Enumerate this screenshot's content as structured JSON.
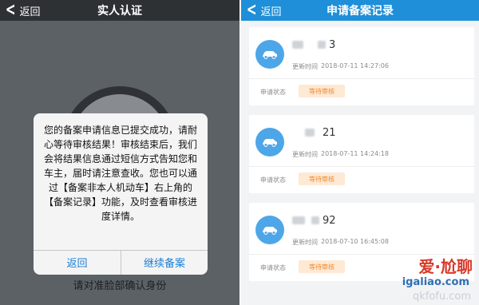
{
  "left": {
    "nav": {
      "back_label": "返回",
      "title": "实人认证"
    },
    "dialog": {
      "message": "您的备案申请信息已提交成功，请耐心等待审核结果！审核结束后，我们会将结果信息通过短信方式告知您和车主，届时请注意查收。您也可以通过【备案非本人机动车】右上角的【备案记录】功能，及时查看审核进度详情。",
      "back_button": "返回",
      "continue_button": "继续备案"
    },
    "hint": "请对准脸部确认身份"
  },
  "right": {
    "nav": {
      "back_label": "返回",
      "title": "申请备案记录"
    },
    "records": [
      {
        "name_suffix": "3",
        "time_label": "更新时间",
        "time": "2018-07-11 14:27:06",
        "status_label": "申请状态",
        "status": "等待审核"
      },
      {
        "name_suffix": "21",
        "time_label": "更新时间",
        "time": "2018-07-11 14:24:18",
        "status_label": "申请状态",
        "status": "等待审核"
      },
      {
        "name_suffix": "92",
        "time_label": "更新时间",
        "time": "2018-07-10 16:45:08",
        "status_label": "申请状态",
        "status": "等待审核"
      }
    ]
  },
  "watermark": {
    "line1": "爱·尬聊",
    "line2": "igaliao.com",
    "line3": "qkfofu.com"
  },
  "colors": {
    "primary_blue": "#1e8fd8",
    "status_orange": "#f08a2a",
    "status_bg": "#fde9d4",
    "icon_blue": "#4da6e8"
  }
}
